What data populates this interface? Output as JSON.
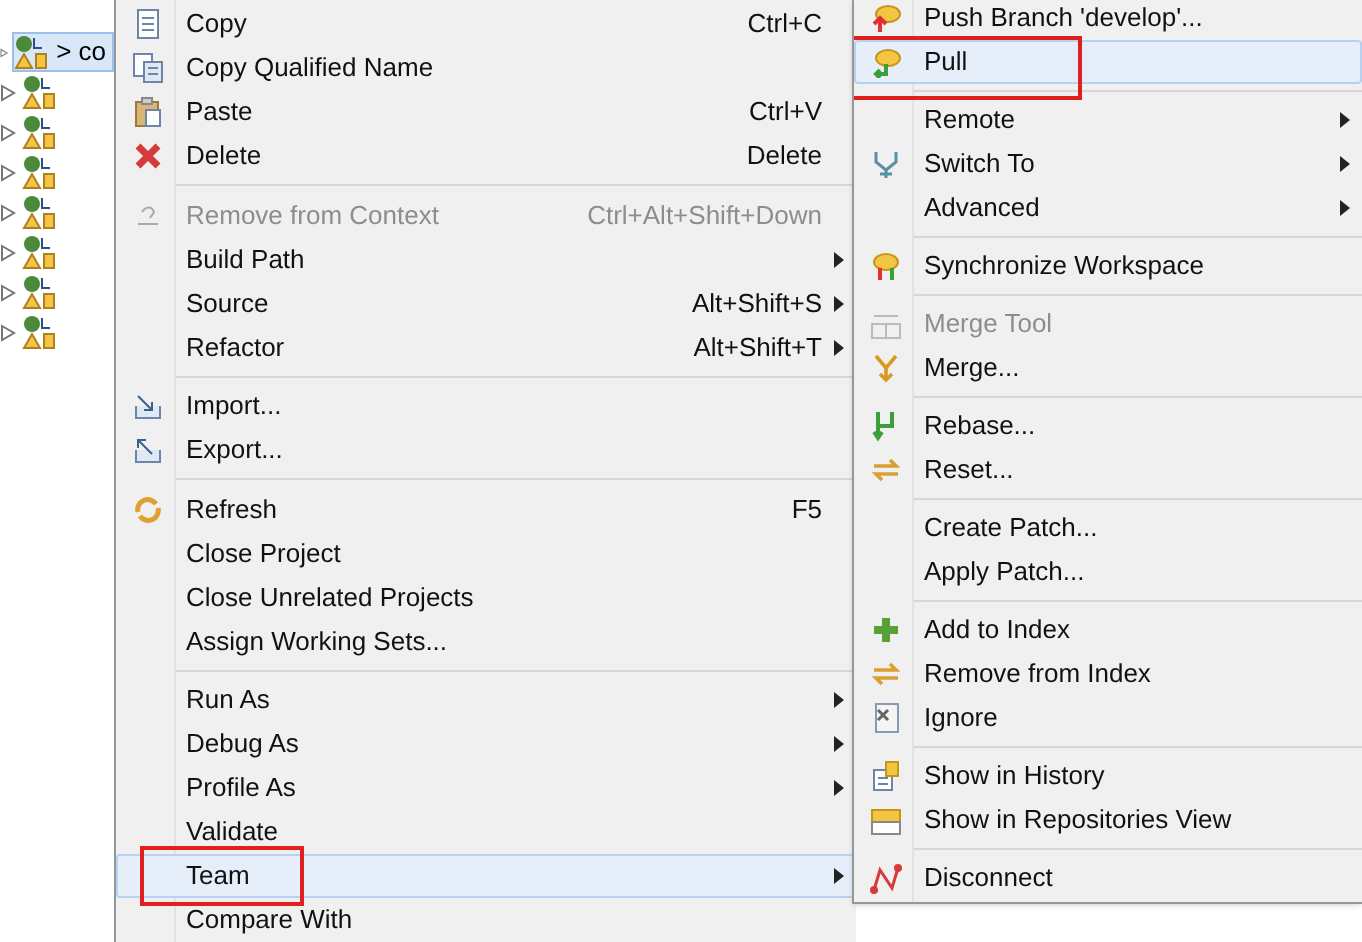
{
  "tree": {
    "rows": [
      {
        "label": "> co",
        "selected": true
      },
      {
        "selected": false
      },
      {
        "selected": false
      },
      {
        "selected": false
      },
      {
        "selected": false
      },
      {
        "selected": false
      },
      {
        "selected": false
      },
      {
        "selected": false
      }
    ]
  },
  "context_menu": {
    "items": [
      {
        "kind": "item",
        "label": "Copy",
        "shortcut": "Ctrl+C",
        "submenu": false,
        "disabled": false,
        "selected": false,
        "annotated": false
      },
      {
        "kind": "item",
        "label": "Copy Qualified Name",
        "submenu": false,
        "disabled": false,
        "selected": false,
        "annotated": false
      },
      {
        "kind": "item",
        "label": "Paste",
        "shortcut": "Ctrl+V",
        "submenu": false,
        "disabled": false,
        "selected": false,
        "annotated": false
      },
      {
        "kind": "item",
        "label": "Delete",
        "shortcut": "Delete",
        "submenu": false,
        "disabled": false,
        "selected": false,
        "annotated": false
      },
      {
        "kind": "separator"
      },
      {
        "kind": "item",
        "label": "Remove from Context",
        "shortcut": "Ctrl+Alt+Shift+Down",
        "submenu": false,
        "disabled": true,
        "selected": false,
        "annotated": false
      },
      {
        "kind": "item",
        "label": "Build Path",
        "submenu": true,
        "disabled": false,
        "selected": false,
        "annotated": false
      },
      {
        "kind": "item",
        "label": "Source",
        "shortcut": "Alt+Shift+S",
        "submenu": true,
        "disabled": false,
        "selected": false,
        "annotated": false
      },
      {
        "kind": "item",
        "label": "Refactor",
        "shortcut": "Alt+Shift+T",
        "submenu": true,
        "disabled": false,
        "selected": false,
        "annotated": false
      },
      {
        "kind": "separator"
      },
      {
        "kind": "item",
        "label": "Import...",
        "submenu": false,
        "disabled": false,
        "selected": false,
        "annotated": false
      },
      {
        "kind": "item",
        "label": "Export...",
        "submenu": false,
        "disabled": false,
        "selected": false,
        "annotated": false
      },
      {
        "kind": "separator"
      },
      {
        "kind": "item",
        "label": "Refresh",
        "shortcut": "F5",
        "submenu": false,
        "disabled": false,
        "selected": false,
        "annotated": false
      },
      {
        "kind": "item",
        "label": "Close Project",
        "submenu": false,
        "disabled": false,
        "selected": false,
        "annotated": false
      },
      {
        "kind": "item",
        "label": "Close Unrelated Projects",
        "submenu": false,
        "disabled": false,
        "selected": false,
        "annotated": false
      },
      {
        "kind": "item",
        "label": "Assign Working Sets...",
        "submenu": false,
        "disabled": false,
        "selected": false,
        "annotated": false
      },
      {
        "kind": "separator"
      },
      {
        "kind": "item",
        "label": "Run As",
        "submenu": true,
        "disabled": false,
        "selected": false,
        "annotated": false
      },
      {
        "kind": "item",
        "label": "Debug As",
        "submenu": true,
        "disabled": false,
        "selected": false,
        "annotated": false
      },
      {
        "kind": "item",
        "label": "Profile As",
        "submenu": true,
        "disabled": false,
        "selected": false,
        "annotated": false
      },
      {
        "kind": "item",
        "label": "Validate",
        "submenu": false,
        "disabled": false,
        "selected": false,
        "annotated": false
      },
      {
        "kind": "item",
        "label": "Team",
        "submenu": true,
        "disabled": false,
        "selected": true,
        "annotated": true
      },
      {
        "kind": "item",
        "label": "Compare With",
        "submenu": false,
        "disabled": false,
        "selected": false,
        "annotated": false
      }
    ]
  },
  "team_submenu": {
    "items": [
      {
        "kind": "item",
        "label": "Push Branch 'develop'...",
        "submenu": false,
        "disabled": false,
        "selected": false,
        "annotated": false
      },
      {
        "kind": "item",
        "label": "Pull",
        "submenu": false,
        "disabled": false,
        "selected": true,
        "annotated": true
      },
      {
        "kind": "separator"
      },
      {
        "kind": "item",
        "label": "Remote",
        "submenu": true,
        "disabled": false,
        "selected": false,
        "annotated": false
      },
      {
        "kind": "item",
        "label": "Switch To",
        "submenu": true,
        "disabled": false,
        "selected": false,
        "annotated": false
      },
      {
        "kind": "item",
        "label": "Advanced",
        "submenu": true,
        "disabled": false,
        "selected": false,
        "annotated": false
      },
      {
        "kind": "separator"
      },
      {
        "kind": "item",
        "label": "Synchronize Workspace",
        "submenu": false,
        "disabled": false,
        "selected": false,
        "annotated": false
      },
      {
        "kind": "separator"
      },
      {
        "kind": "item",
        "label": "Merge Tool",
        "submenu": false,
        "disabled": true,
        "selected": false,
        "annotated": false
      },
      {
        "kind": "item",
        "label": "Merge...",
        "submenu": false,
        "disabled": false,
        "selected": false,
        "annotated": false
      },
      {
        "kind": "separator"
      },
      {
        "kind": "item",
        "label": "Rebase...",
        "submenu": false,
        "disabled": false,
        "selected": false,
        "annotated": false
      },
      {
        "kind": "item",
        "label": "Reset...",
        "submenu": false,
        "disabled": false,
        "selected": false,
        "annotated": false
      },
      {
        "kind": "separator"
      },
      {
        "kind": "item",
        "label": "Create Patch...",
        "submenu": false,
        "disabled": false,
        "selected": false,
        "annotated": false
      },
      {
        "kind": "item",
        "label": "Apply Patch...",
        "submenu": false,
        "disabled": false,
        "selected": false,
        "annotated": false
      },
      {
        "kind": "separator"
      },
      {
        "kind": "item",
        "label": "Add to Index",
        "submenu": false,
        "disabled": false,
        "selected": false,
        "annotated": false
      },
      {
        "kind": "item",
        "label": "Remove from Index",
        "submenu": false,
        "disabled": false,
        "selected": false,
        "annotated": false
      },
      {
        "kind": "item",
        "label": "Ignore",
        "submenu": false,
        "disabled": false,
        "selected": false,
        "annotated": false
      },
      {
        "kind": "separator"
      },
      {
        "kind": "item",
        "label": "Show in History",
        "submenu": false,
        "disabled": false,
        "selected": false,
        "annotated": false
      },
      {
        "kind": "item",
        "label": "Show in Repositories View",
        "submenu": false,
        "disabled": false,
        "selected": false,
        "annotated": false
      },
      {
        "kind": "separator"
      },
      {
        "kind": "item",
        "label": "Disconnect",
        "submenu": false,
        "disabled": false,
        "selected": false,
        "annotated": false
      }
    ]
  }
}
